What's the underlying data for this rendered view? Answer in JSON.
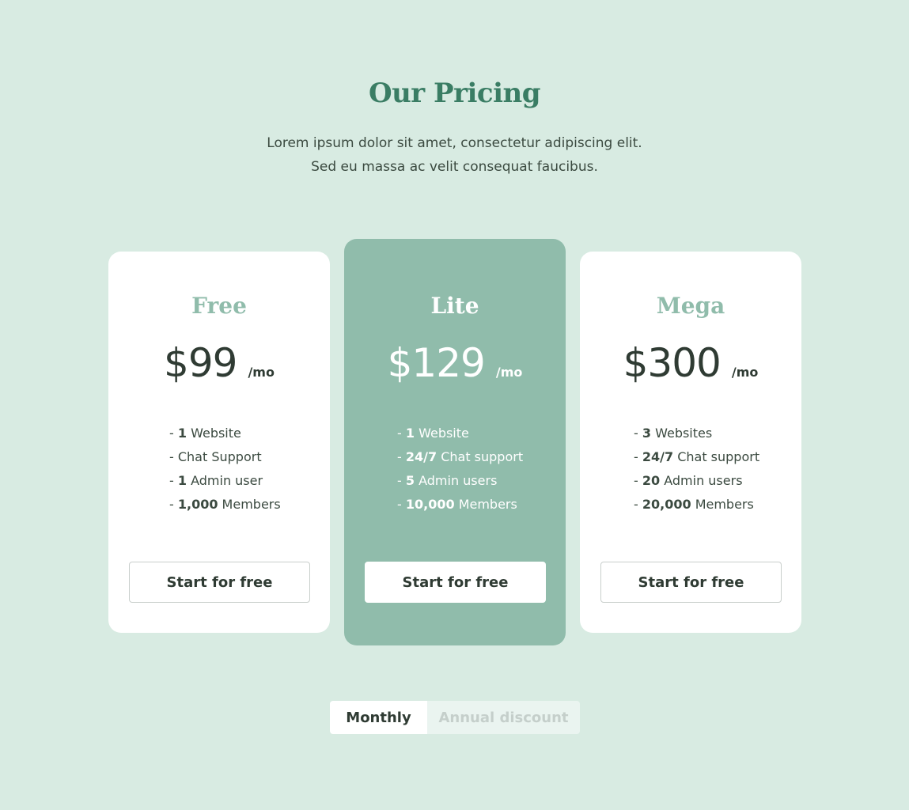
{
  "header": {
    "title": "Our Pricing",
    "subtitle_line1": "Lorem ipsum dolor sit amet, consectetur adipiscing elit.",
    "subtitle_line2": "Sed eu massa ac velit consequat faucibus."
  },
  "colors": {
    "background": "#d8ebe2",
    "accent": "#3a7d64",
    "featured_card": "#90bcab",
    "text": "#2f3b33"
  },
  "plans": [
    {
      "name": "Free",
      "price": "$99",
      "period": "/mo",
      "features": [
        {
          "prefix": "- ",
          "bold": "1",
          "text": " Website"
        },
        {
          "prefix": "- ",
          "bold": "",
          "text": "Chat Support"
        },
        {
          "prefix": "- ",
          "bold": "1",
          "text": " Admin user"
        },
        {
          "prefix": "- ",
          "bold": "1,000",
          "text": " Members"
        }
      ],
      "cta": "Start for free"
    },
    {
      "name": "Lite",
      "price": "$129",
      "period": "/mo",
      "featured": true,
      "features": [
        {
          "prefix": "- ",
          "bold": "1",
          "text": " Website"
        },
        {
          "prefix": "- ",
          "bold": "24/7",
          "text": " Chat support"
        },
        {
          "prefix": "- ",
          "bold": "5",
          "text": " Admin users"
        },
        {
          "prefix": "- ",
          "bold": "10,000",
          "text": " Members"
        }
      ],
      "cta": "Start for free"
    },
    {
      "name": "Mega",
      "price": "$300",
      "period": "/mo",
      "features": [
        {
          "prefix": "- ",
          "bold": "3",
          "text": " Websites"
        },
        {
          "prefix": "- ",
          "bold": "24/7",
          "text": " Chat support"
        },
        {
          "prefix": "- ",
          "bold": "20",
          "text": " Admin users"
        },
        {
          "prefix": "- ",
          "bold": "20,000",
          "text": " Members"
        }
      ],
      "cta": "Start for free"
    }
  ],
  "billing_toggle": {
    "options": [
      "Monthly",
      "Annual discount"
    ],
    "selected": "Monthly"
  }
}
